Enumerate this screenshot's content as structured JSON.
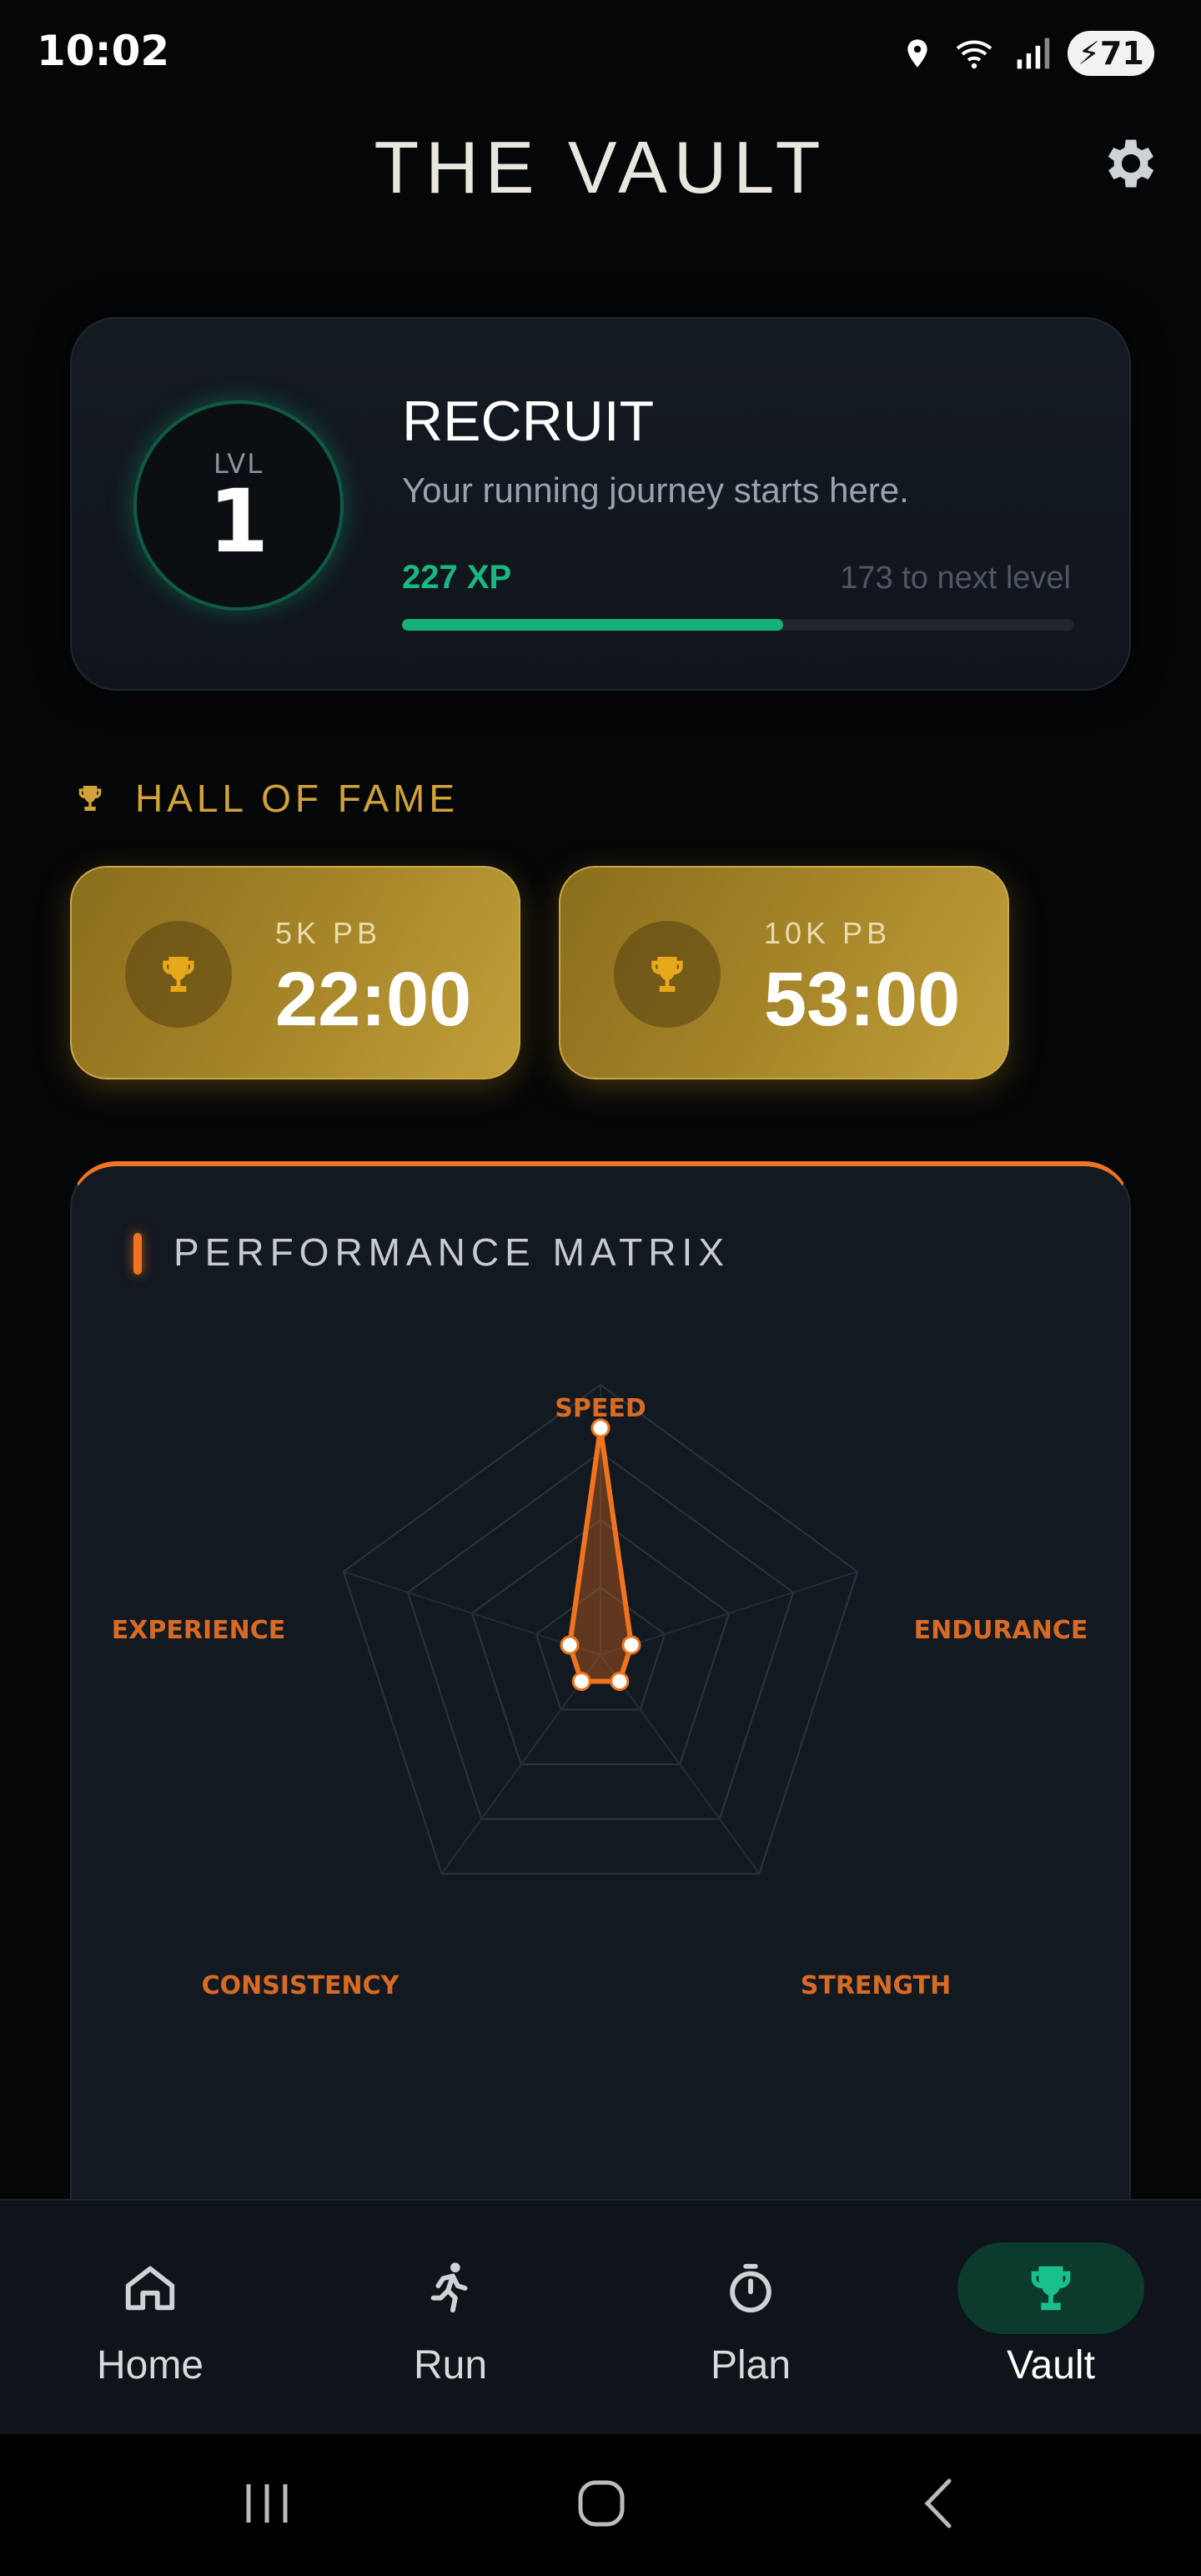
{
  "status_bar": {
    "time": "10:02",
    "battery": "71"
  },
  "header": {
    "title": "THE VAULT"
  },
  "level_card": {
    "level_label": "LVL",
    "level_value": "1",
    "rank": "RECRUIT",
    "subtitle": "Your running journey starts here.",
    "xp": "227 XP",
    "xp_to_next": "173 to next level",
    "progress_fraction": 0.567
  },
  "hall_of_fame": {
    "title": "HALL OF FAME",
    "records": [
      {
        "label": "5K PB",
        "value": "22:00"
      },
      {
        "label": "10K PB",
        "value": "53:00"
      }
    ]
  },
  "performance": {
    "title": "PERFORMANCE MATRIX",
    "axes": [
      "SPEED",
      "ENDURANCE",
      "STRENGTH",
      "CONSISTENCY",
      "EXPERIENCE"
    ],
    "values": [
      0.84,
      0.12,
      0.12,
      0.12,
      0.12
    ],
    "accent_color": "#f07420"
  },
  "nav": {
    "items": [
      {
        "label": "Home",
        "icon": "home-icon",
        "active": false
      },
      {
        "label": "Run",
        "icon": "runner-icon",
        "active": false
      },
      {
        "label": "Plan",
        "icon": "stopwatch-icon",
        "active": false
      },
      {
        "label": "Vault",
        "icon": "trophy-icon",
        "active": true
      }
    ]
  },
  "colors": {
    "primary_green": "#16b07d",
    "gold": "#d2a23b",
    "orange": "#f07420"
  }
}
